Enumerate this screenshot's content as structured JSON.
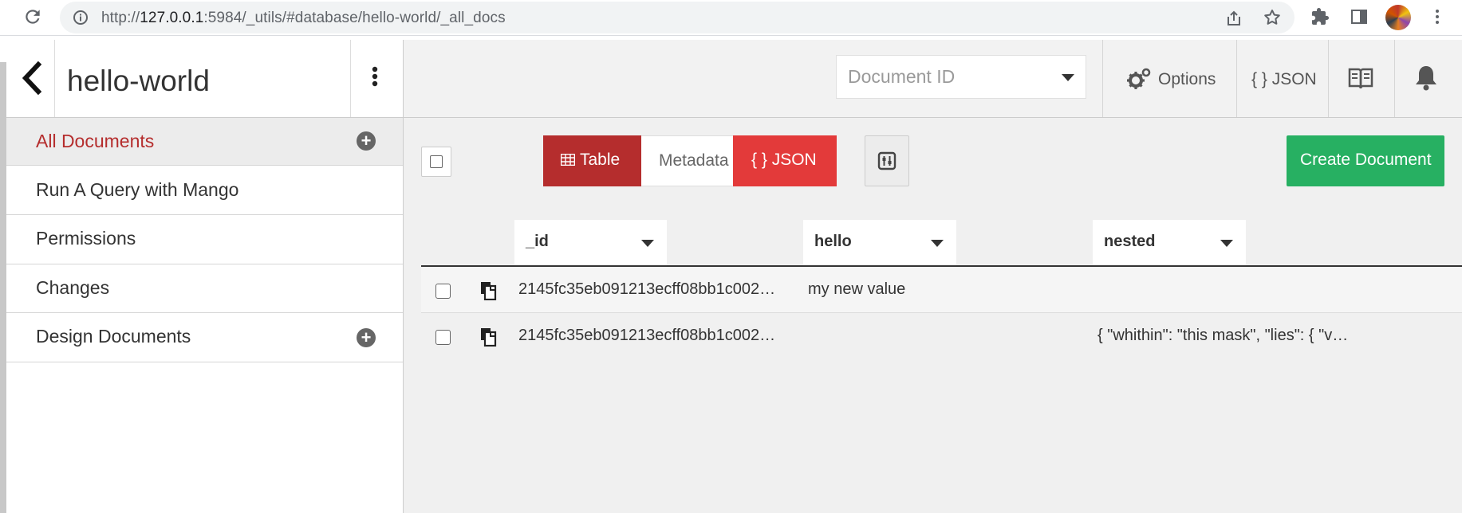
{
  "browser": {
    "url_prefix": "http://",
    "url_host": "127.0.0.1",
    "url_rest": ":5984/_utils/#database/hello-world/_all_docs"
  },
  "sidebar": {
    "db_name": "hello-world",
    "items": [
      {
        "label": "All Documents",
        "active": true,
        "has_add": true
      },
      {
        "label": "Run A Query with Mango",
        "active": false,
        "has_add": false
      },
      {
        "label": "Permissions",
        "active": false,
        "has_add": false
      },
      {
        "label": "Changes",
        "active": false,
        "has_add": false
      },
      {
        "label": "Design Documents",
        "active": false,
        "has_add": true
      }
    ]
  },
  "header": {
    "doc_id_placeholder": "Document ID",
    "options_label": "Options",
    "json_label": "{ } JSON"
  },
  "toolbar": {
    "table_label": "Table",
    "metadata_label": "Metadata",
    "json_label": "{ } JSON",
    "create_label": "Create Document"
  },
  "table": {
    "columns": [
      "_id",
      "hello",
      "nested"
    ],
    "rows": [
      {
        "id": "2145fc35eb091213ecff08bb1c002…",
        "hello": "my new value",
        "nested": ""
      },
      {
        "id": "2145fc35eb091213ecff08bb1c002…",
        "hello": "",
        "nested": "{ \"whithin\": \"this mask\", \"lies\": { \"v…"
      }
    ]
  },
  "colors": {
    "accent_red": "#b52d2d",
    "json_red": "#e33a3a",
    "create_green": "#27b062"
  }
}
